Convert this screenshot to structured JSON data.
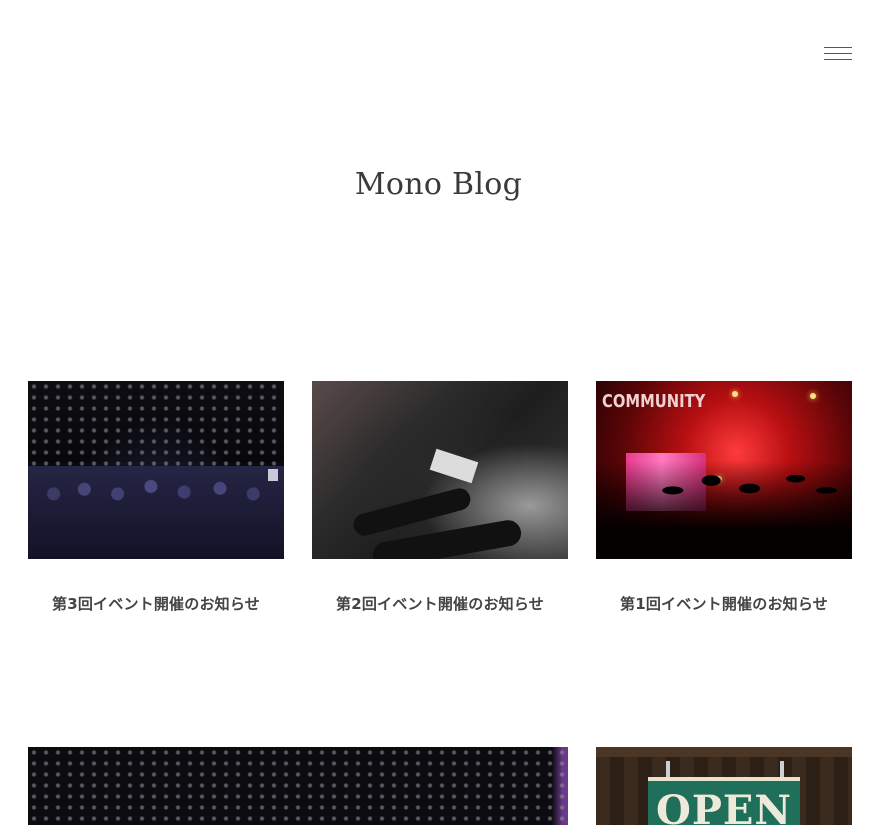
{
  "header": {
    "menu_icon": "hamburger-menu-icon",
    "title": "Mono Blog"
  },
  "posts": [
    {
      "title": "第3回イベント開催のお知らせ",
      "image": "event-hall-audience"
    },
    {
      "title": "第2回イベント開催のお知らせ",
      "image": "seated-people-notebook"
    },
    {
      "title": "第1回イベント開催のお知らせ",
      "image": "community-concert"
    }
  ],
  "posts_row2": [
    {
      "image": "dark-hall-bokeh"
    },
    {
      "image": "open-sign",
      "sign_text": "OPEN"
    }
  ]
}
